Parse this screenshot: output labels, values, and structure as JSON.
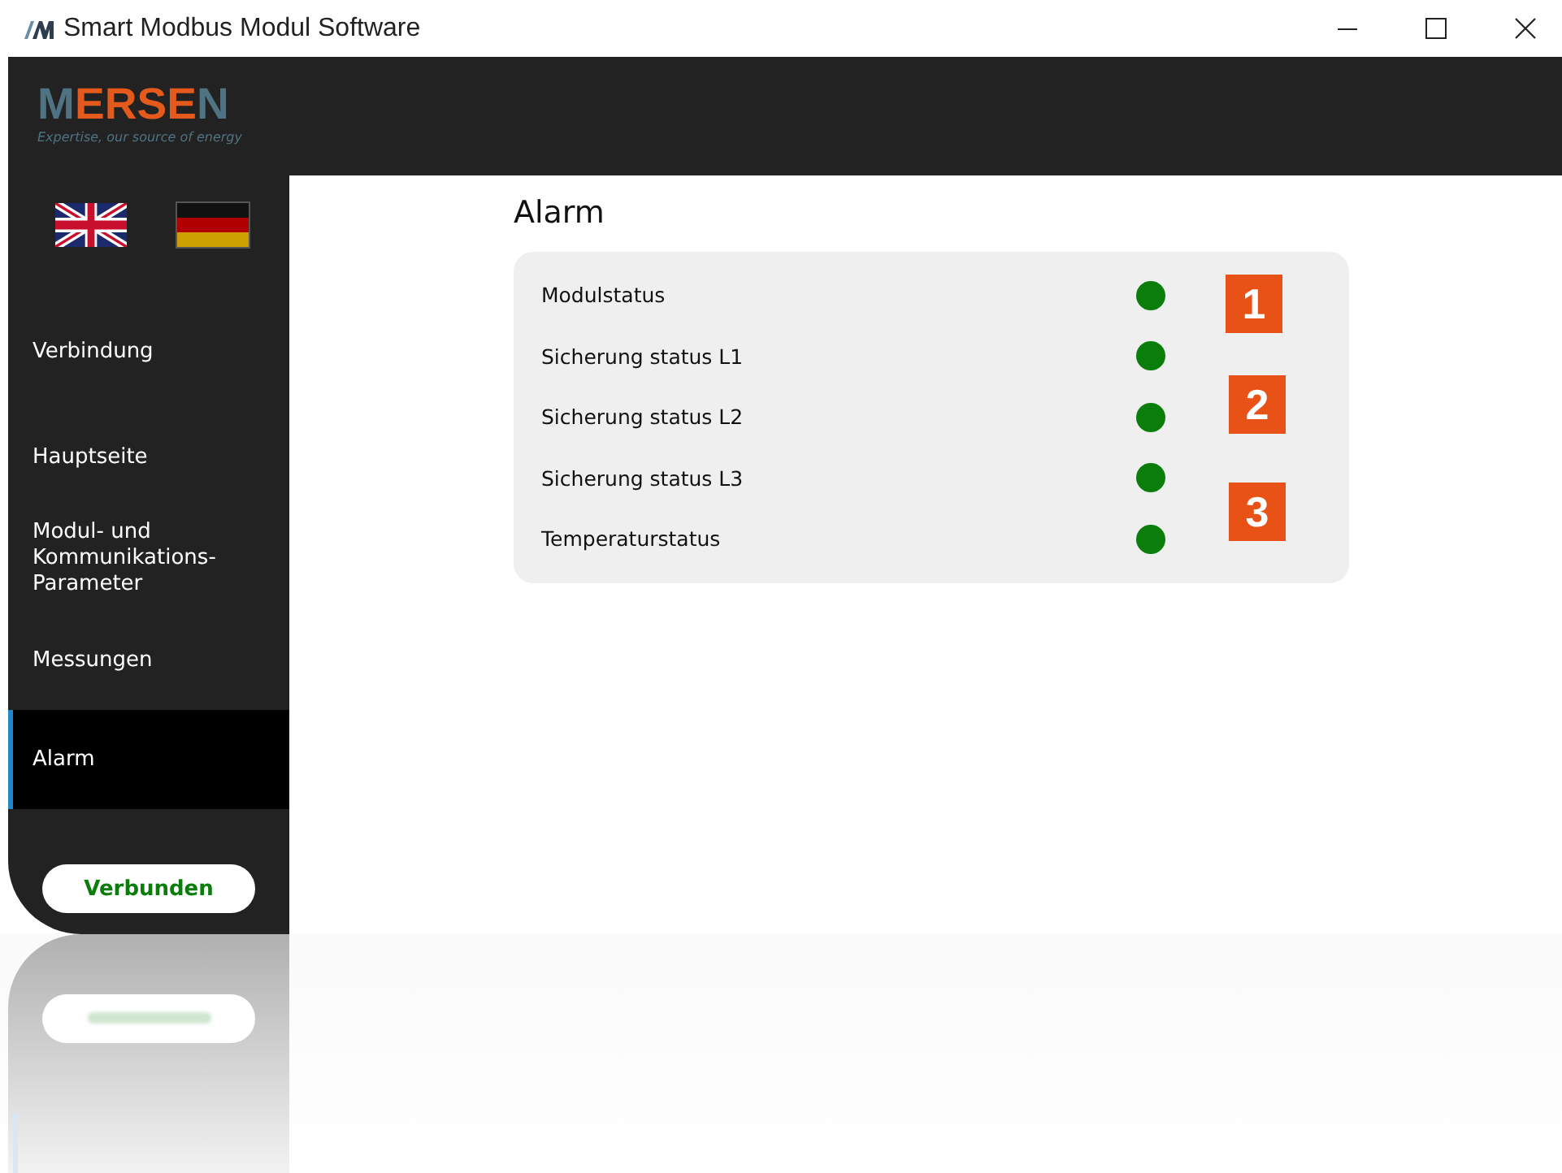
{
  "window": {
    "title": "Smart Modbus Modul Software"
  },
  "logo": {
    "lead": "M",
    "middle": "ERSE",
    "tail": "N",
    "tagline": "Expertise, our source of energy"
  },
  "languages": [
    {
      "kind": "uk",
      "selected": false
    },
    {
      "kind": "de",
      "selected": true
    }
  ],
  "sidebar": {
    "items": [
      {
        "label": "Verbindung",
        "selected": false
      },
      {
        "label": "Hauptseite",
        "selected": false
      },
      {
        "label": "Modul- und Kommunikations-Parameter",
        "selected": false
      },
      {
        "label": "Messungen",
        "selected": false
      },
      {
        "label": "Alarm",
        "selected": true
      }
    ],
    "connection_button": "Verbunden"
  },
  "page": {
    "title": "Alarm",
    "alarms": [
      {
        "label": "Modulstatus",
        "color": "#0a7d0a"
      },
      {
        "label": "Sicherung status L1",
        "color": "#0a7d0a"
      },
      {
        "label": "Sicherung status L2",
        "color": "#0a7d0a"
      },
      {
        "label": "Sicherung status L3",
        "color": "#0a7d0a"
      },
      {
        "label": "Temperaturstatus",
        "color": "#0a7d0a"
      }
    ],
    "callouts": [
      "1",
      "2",
      "3"
    ]
  }
}
